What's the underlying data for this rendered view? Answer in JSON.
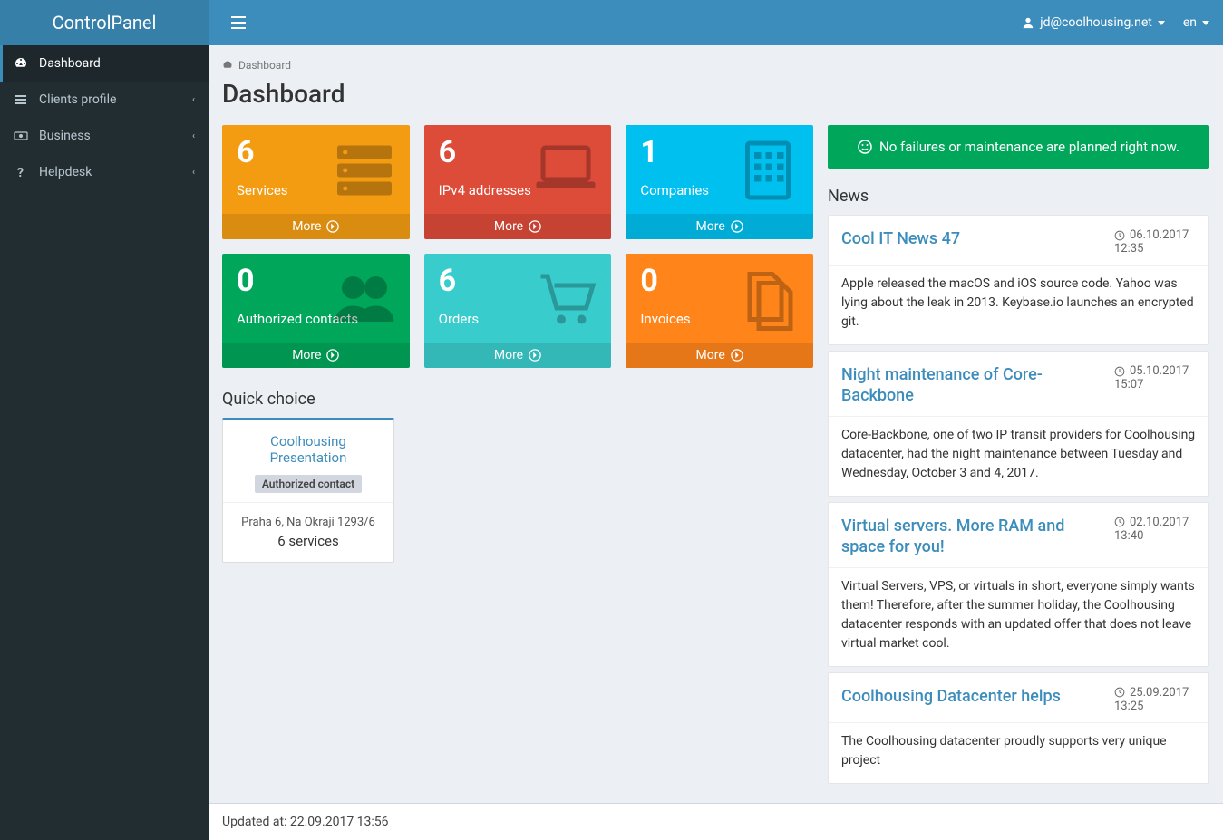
{
  "brand": "ControlPanel",
  "user_email": "jd@coolhousing.net",
  "language": "en",
  "breadcrumb": "Dashboard",
  "page_title": "Dashboard",
  "sidebar": {
    "items": [
      {
        "label": "Dashboard",
        "icon": "dashboard-icon"
      },
      {
        "label": "Clients profile",
        "icon": "list-icon"
      },
      {
        "label": "Business",
        "icon": "money-icon"
      },
      {
        "label": "Helpdesk",
        "icon": "question-icon"
      }
    ]
  },
  "tiles": [
    {
      "count": "6",
      "label": "Services",
      "more": "More",
      "color": "yellow",
      "icon": "server-icon"
    },
    {
      "count": "6",
      "label": "IPv4 addresses",
      "more": "More",
      "color": "red",
      "icon": "laptop-icon"
    },
    {
      "count": "1",
      "label": "Companies",
      "more": "More",
      "color": "blue",
      "icon": "building-icon"
    },
    {
      "count": "0",
      "label": "Authorized contacts",
      "more": "More",
      "color": "green",
      "icon": "users-icon"
    },
    {
      "count": "6",
      "label": "Orders",
      "more": "More",
      "color": "teal",
      "icon": "cart-icon"
    },
    {
      "count": "0",
      "label": "Invoices",
      "more": "More",
      "color": "orange",
      "icon": "files-icon"
    }
  ],
  "quick_choice": {
    "heading": "Quick choice",
    "link": "Coolhousing Presentation",
    "badge": "Authorized contact",
    "address": "Praha 6, Na Okraji 1293/6",
    "services": "6 services"
  },
  "status_message": "No failures or maintenance are planned right now.",
  "news_heading": "News",
  "news": [
    {
      "title": "Cool IT News 47",
      "date": "06.10.2017",
      "time": "12:35",
      "body": "Apple released the macOS and iOS source code. Yahoo was lying about the leak in 2013. Keybase.io launches an encrypted git."
    },
    {
      "title": "Night maintenance of Core-Backbone",
      "date": "05.10.2017",
      "time": "15:07",
      "body": "Core-Backbone, one of two IP transit providers for Coolhousing datacenter, had the night maintenance between Tuesday and Wednesday, October 3 and 4, 2017."
    },
    {
      "title": "Virtual servers. More RAM and space for you!",
      "date": "02.10.2017",
      "time": "13:40",
      "body": "Virtual Servers, VPS, or virtuals in short, everyone simply wants them! Therefore, after the summer holiday, the Coolhousing datacenter responds with an updated offer that does not leave virtual market cool."
    },
    {
      "title": "Coolhousing Datacenter helps",
      "date": "25.09.2017",
      "time": "13:25",
      "body": "The Coolhousing datacenter proudly supports very unique project"
    }
  ],
  "footer_text": "Updated at: 22.09.2017 13:56"
}
